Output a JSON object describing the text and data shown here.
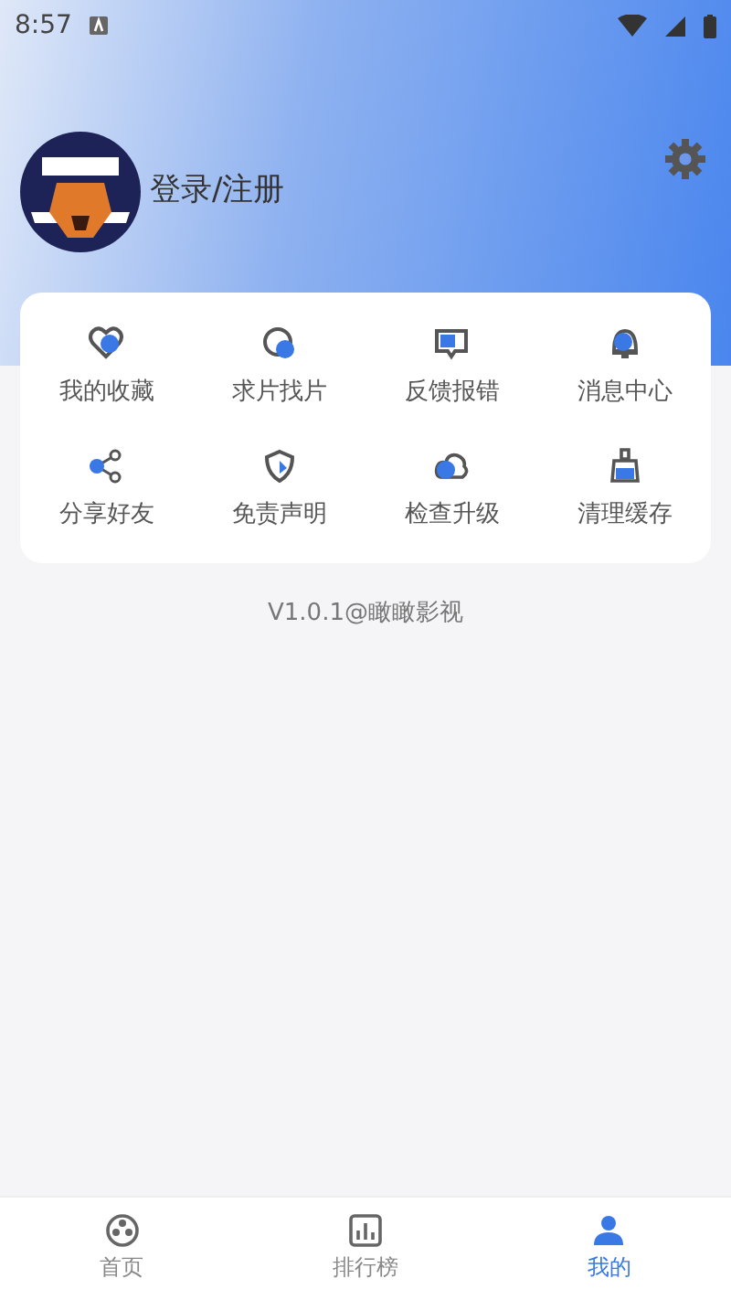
{
  "status_bar": {
    "time": "8:57"
  },
  "profile": {
    "login_label": "登录/注册"
  },
  "menu": {
    "items": [
      {
        "label": "我的收藏"
      },
      {
        "label": "求片找片"
      },
      {
        "label": "反馈报错"
      },
      {
        "label": "消息中心"
      },
      {
        "label": "分享好友"
      },
      {
        "label": "免责声明"
      },
      {
        "label": "检查升级"
      },
      {
        "label": "清理缓存"
      }
    ]
  },
  "version": "V1.0.1@瞰瞰影视",
  "tab_bar": {
    "tabs": [
      {
        "label": "首页",
        "selected": false
      },
      {
        "label": "排行榜",
        "selected": false
      },
      {
        "label": "我的",
        "selected": true
      }
    ]
  }
}
